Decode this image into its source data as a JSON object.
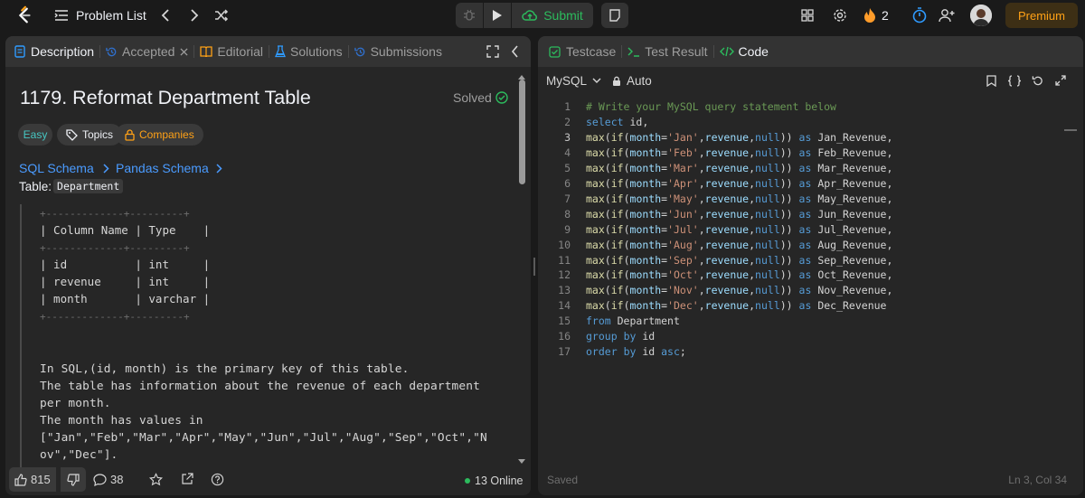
{
  "topbar": {
    "problem_list": "Problem List",
    "submit": "Submit",
    "streak": "2",
    "premium": "Premium",
    "accent": "#2cbb5d",
    "premium_color": "#ffa116"
  },
  "left": {
    "tabs": [
      "Description",
      "Accepted",
      "Editorial",
      "Solutions",
      "Submissions"
    ],
    "title": "1179. Reformat Department Table",
    "solved": "Solved",
    "tags": [
      "Easy",
      "Topics",
      "Companies"
    ],
    "links": [
      "SQL Schema",
      "Pandas Schema"
    ],
    "table_label": "Table: ",
    "table_name": "Department",
    "schema": [
      "+-------------+---------+",
      "| Column Name | Type    |",
      "+-------------+---------+",
      "| id          | int     |",
      "| revenue     | int     |",
      "| month       | varchar |",
      "+-------------+---------+"
    ],
    "desc": [
      "In SQL,(id, month) is the primary key of this table.",
      "The table has information about the revenue of each department",
      "per month.",
      "The month has values in",
      "[\"Jan\",\"Feb\",\"Mar\",\"Apr\",\"May\",\"Jun\",\"Jul\",\"Aug\",\"Sep\",\"Oct\",\"N",
      "ov\",\"Dec\"]."
    ],
    "likes": "815",
    "comments": "38",
    "online": "13 Online"
  },
  "right": {
    "tabs": [
      "Testcase",
      "Test Result",
      "Code"
    ],
    "language": "MySQL",
    "mode": "Auto",
    "saved": "Saved",
    "cursor": "Ln 3, Col 34",
    "code": [
      "# Write your MySQL query statement below",
      "select id,",
      "max(if(month='Jan',revenue,null)) as Jan_Revenue,",
      "max(if(month='Feb',revenue,null)) as Feb_Revenue,",
      "max(if(month='Mar',revenue,null)) as Mar_Revenue,",
      "max(if(month='Apr',revenue,null)) as Apr_Revenue,",
      "max(if(month='May',revenue,null)) as May_Revenue,",
      "max(if(month='Jun',revenue,null)) as Jun_Revenue,",
      "max(if(month='Jul',revenue,null)) as Jul_Revenue,",
      "max(if(month='Aug',revenue,null)) as Aug_Revenue,",
      "max(if(month='Sep',revenue,null)) as Sep_Revenue,",
      "max(if(month='Oct',revenue,null)) as Oct_Revenue,",
      "max(if(month='Nov',revenue,null)) as Nov_Revenue,",
      "max(if(month='Dec',revenue,null)) as Dec_Revenue",
      "from Department",
      "group by id",
      "order by id asc;"
    ]
  }
}
